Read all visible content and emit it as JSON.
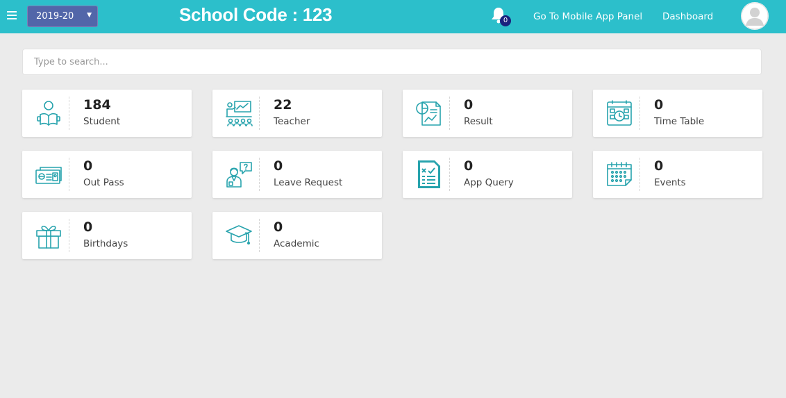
{
  "header": {
    "year_select": "2019-20",
    "title": "School Code : 123",
    "notification_count": "0",
    "links": [
      "Go To Mobile App Panel",
      "Dashboard"
    ]
  },
  "search": {
    "placeholder": "Type to search..."
  },
  "cards": [
    {
      "count": "184",
      "label": "Student",
      "icon": "student-icon"
    },
    {
      "count": "22",
      "label": "Teacher",
      "icon": "teacher-icon"
    },
    {
      "count": "0",
      "label": "Result",
      "icon": "result-icon"
    },
    {
      "count": "0",
      "label": "Time Table",
      "icon": "timetable-icon"
    },
    {
      "count": "0",
      "label": "Out Pass",
      "icon": "out-pass-icon"
    },
    {
      "count": "0",
      "label": "Leave Request",
      "icon": "leave-request-icon"
    },
    {
      "count": "0",
      "label": "App Query",
      "icon": "app-query-icon"
    },
    {
      "count": "0",
      "label": "Events",
      "icon": "events-icon"
    },
    {
      "count": "0",
      "label": "Birthdays",
      "icon": "birthdays-icon"
    },
    {
      "count": "0",
      "label": "Academic",
      "icon": "academic-icon"
    }
  ],
  "colors": {
    "topbar": "#2cbfcb",
    "select": "#5266a9",
    "icon": "#27a3ad",
    "badge": "#1a237e"
  }
}
